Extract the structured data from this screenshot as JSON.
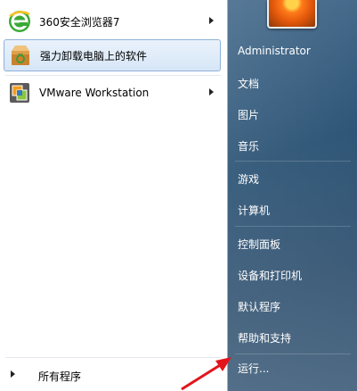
{
  "programs": [
    {
      "label": "360安全浏览器7",
      "has_submenu": true,
      "icon": "360-browser-icon"
    },
    {
      "label": "强力卸载电脑上的软件",
      "has_submenu": false,
      "icon": "uninstaller-box-icon"
    },
    {
      "label": "VMware Workstation",
      "has_submenu": true,
      "icon": "vmware-icon"
    }
  ],
  "all_programs_label": "所有程序",
  "right_menu": {
    "user": "Administrator",
    "documents": "文档",
    "pictures": "图片",
    "music": "音乐",
    "games": "游戏",
    "computer": "计算机",
    "control_panel": "控制面板",
    "devices_printers": "设备和打印机",
    "default_programs": "默认程序",
    "help_support": "帮助和支持",
    "run": "运行..."
  },
  "colors": {
    "selected_bg": "#d6e6f7",
    "right_pane": "#2f5677",
    "annotation_arrow": "#e3151a"
  }
}
